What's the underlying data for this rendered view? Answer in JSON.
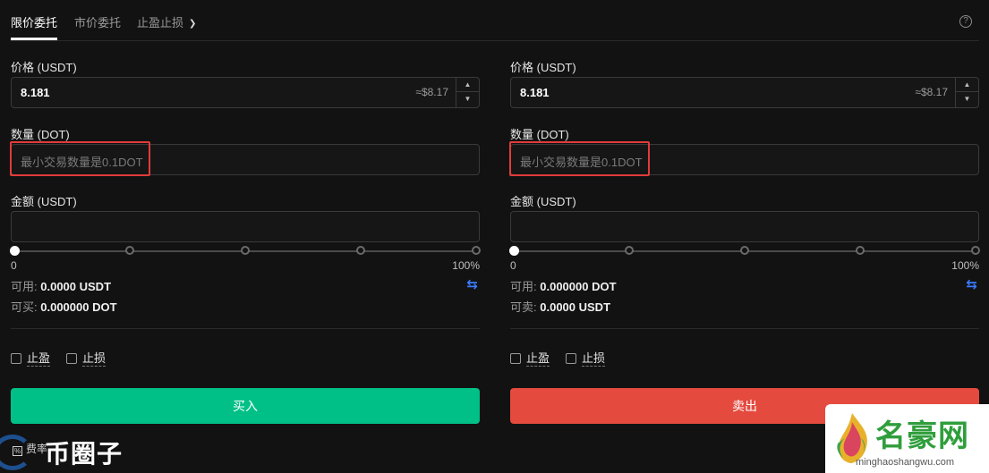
{
  "tabs": {
    "limit": "限价委托",
    "market": "市价委托",
    "stop": "止盈止损"
  },
  "help_icon": "?",
  "buy": {
    "price_label": "价格 (USDT)",
    "price_value": "8.181",
    "price_approx": "≈$8.17",
    "qty_label": "数量 (DOT)",
    "qty_placeholder": "最小交易数量是0.1DOT",
    "amount_label": "金额 (USDT)",
    "slider_min": "0",
    "slider_max": "100%",
    "available_label": "可用:",
    "available_value": "0.0000 USDT",
    "can_label": "可买:",
    "can_value": "0.000000 DOT",
    "take_profit": "止盈",
    "stop_loss": "止损",
    "button": "买入"
  },
  "sell": {
    "price_label": "价格 (USDT)",
    "price_value": "8.181",
    "price_approx": "≈$8.17",
    "qty_label": "数量 (DOT)",
    "qty_placeholder": "最小交易数量是0.1DOT",
    "amount_label": "金额 (USDT)",
    "slider_min": "0",
    "slider_max": "100%",
    "available_label": "可用:",
    "available_value": "0.000000 DOT",
    "can_label": "可卖:",
    "can_value": "0.0000 USDT",
    "take_profit": "止盈",
    "stop_loss": "止损",
    "button": "卖出"
  },
  "watermark_left": {
    "fee_label": "费率",
    "brand": "币圈子"
  },
  "watermark_right": {
    "brand": "名豪网",
    "url": "minghaoshangwu.com"
  },
  "colors": {
    "buy": "#00c087",
    "sell": "#e44a3e",
    "highlight": "#e23b3b",
    "accent": "#3a7bff"
  }
}
